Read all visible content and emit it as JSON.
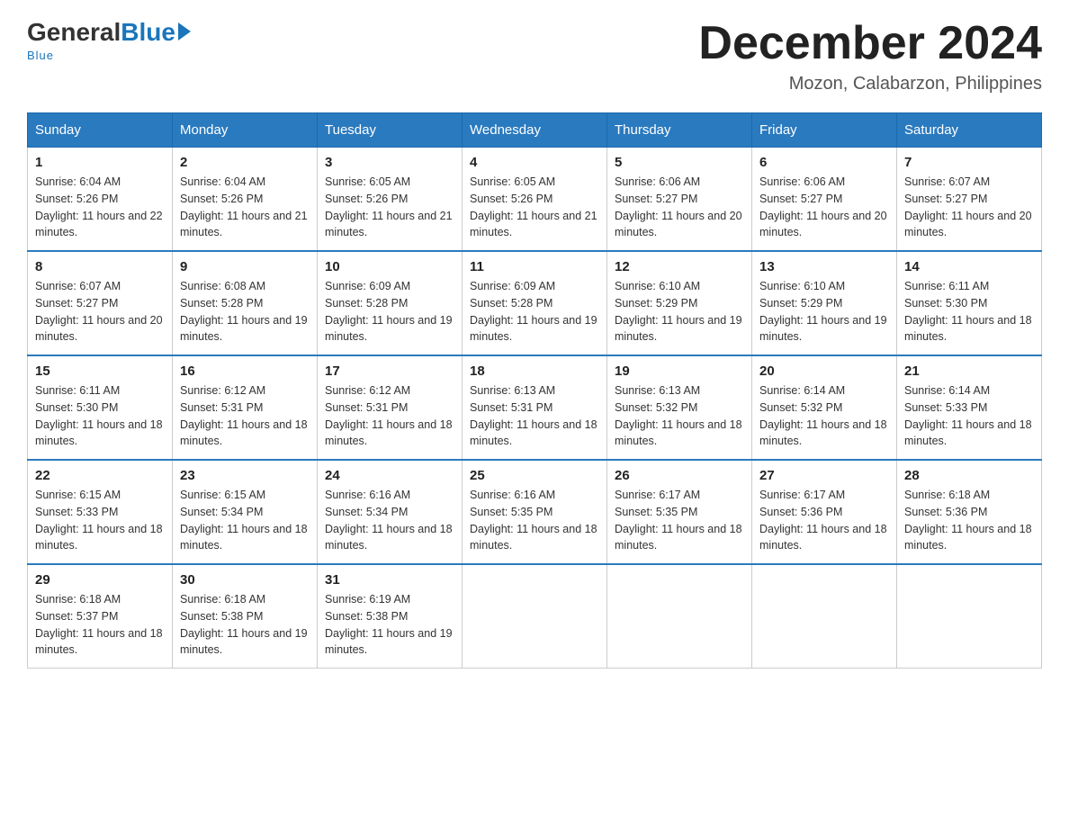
{
  "header": {
    "logo": {
      "general": "General",
      "blue": "Blue",
      "underline": "Blue"
    },
    "title": "December 2024",
    "location": "Mozon, Calabarzon, Philippines"
  },
  "calendar": {
    "days_of_week": [
      "Sunday",
      "Monday",
      "Tuesday",
      "Wednesday",
      "Thursday",
      "Friday",
      "Saturday"
    ],
    "weeks": [
      [
        {
          "day": "1",
          "sunrise": "6:04 AM",
          "sunset": "5:26 PM",
          "daylight": "11 hours and 22 minutes."
        },
        {
          "day": "2",
          "sunrise": "6:04 AM",
          "sunset": "5:26 PM",
          "daylight": "11 hours and 21 minutes."
        },
        {
          "day": "3",
          "sunrise": "6:05 AM",
          "sunset": "5:26 PM",
          "daylight": "11 hours and 21 minutes."
        },
        {
          "day": "4",
          "sunrise": "6:05 AM",
          "sunset": "5:26 PM",
          "daylight": "11 hours and 21 minutes."
        },
        {
          "day": "5",
          "sunrise": "6:06 AM",
          "sunset": "5:27 PM",
          "daylight": "11 hours and 20 minutes."
        },
        {
          "day": "6",
          "sunrise": "6:06 AM",
          "sunset": "5:27 PM",
          "daylight": "11 hours and 20 minutes."
        },
        {
          "day": "7",
          "sunrise": "6:07 AM",
          "sunset": "5:27 PM",
          "daylight": "11 hours and 20 minutes."
        }
      ],
      [
        {
          "day": "8",
          "sunrise": "6:07 AM",
          "sunset": "5:27 PM",
          "daylight": "11 hours and 20 minutes."
        },
        {
          "day": "9",
          "sunrise": "6:08 AM",
          "sunset": "5:28 PM",
          "daylight": "11 hours and 19 minutes."
        },
        {
          "day": "10",
          "sunrise": "6:09 AM",
          "sunset": "5:28 PM",
          "daylight": "11 hours and 19 minutes."
        },
        {
          "day": "11",
          "sunrise": "6:09 AM",
          "sunset": "5:28 PM",
          "daylight": "11 hours and 19 minutes."
        },
        {
          "day": "12",
          "sunrise": "6:10 AM",
          "sunset": "5:29 PM",
          "daylight": "11 hours and 19 minutes."
        },
        {
          "day": "13",
          "sunrise": "6:10 AM",
          "sunset": "5:29 PM",
          "daylight": "11 hours and 19 minutes."
        },
        {
          "day": "14",
          "sunrise": "6:11 AM",
          "sunset": "5:30 PM",
          "daylight": "11 hours and 18 minutes."
        }
      ],
      [
        {
          "day": "15",
          "sunrise": "6:11 AM",
          "sunset": "5:30 PM",
          "daylight": "11 hours and 18 minutes."
        },
        {
          "day": "16",
          "sunrise": "6:12 AM",
          "sunset": "5:31 PM",
          "daylight": "11 hours and 18 minutes."
        },
        {
          "day": "17",
          "sunrise": "6:12 AM",
          "sunset": "5:31 PM",
          "daylight": "11 hours and 18 minutes."
        },
        {
          "day": "18",
          "sunrise": "6:13 AM",
          "sunset": "5:31 PM",
          "daylight": "11 hours and 18 minutes."
        },
        {
          "day": "19",
          "sunrise": "6:13 AM",
          "sunset": "5:32 PM",
          "daylight": "11 hours and 18 minutes."
        },
        {
          "day": "20",
          "sunrise": "6:14 AM",
          "sunset": "5:32 PM",
          "daylight": "11 hours and 18 minutes."
        },
        {
          "day": "21",
          "sunrise": "6:14 AM",
          "sunset": "5:33 PM",
          "daylight": "11 hours and 18 minutes."
        }
      ],
      [
        {
          "day": "22",
          "sunrise": "6:15 AM",
          "sunset": "5:33 PM",
          "daylight": "11 hours and 18 minutes."
        },
        {
          "day": "23",
          "sunrise": "6:15 AM",
          "sunset": "5:34 PM",
          "daylight": "11 hours and 18 minutes."
        },
        {
          "day": "24",
          "sunrise": "6:16 AM",
          "sunset": "5:34 PM",
          "daylight": "11 hours and 18 minutes."
        },
        {
          "day": "25",
          "sunrise": "6:16 AM",
          "sunset": "5:35 PM",
          "daylight": "11 hours and 18 minutes."
        },
        {
          "day": "26",
          "sunrise": "6:17 AM",
          "sunset": "5:35 PM",
          "daylight": "11 hours and 18 minutes."
        },
        {
          "day": "27",
          "sunrise": "6:17 AM",
          "sunset": "5:36 PM",
          "daylight": "11 hours and 18 minutes."
        },
        {
          "day": "28",
          "sunrise": "6:18 AM",
          "sunset": "5:36 PM",
          "daylight": "11 hours and 18 minutes."
        }
      ],
      [
        {
          "day": "29",
          "sunrise": "6:18 AM",
          "sunset": "5:37 PM",
          "daylight": "11 hours and 18 minutes."
        },
        {
          "day": "30",
          "sunrise": "6:18 AM",
          "sunset": "5:38 PM",
          "daylight": "11 hours and 19 minutes."
        },
        {
          "day": "31",
          "sunrise": "6:19 AM",
          "sunset": "5:38 PM",
          "daylight": "11 hours and 19 minutes."
        },
        null,
        null,
        null,
        null
      ]
    ]
  }
}
